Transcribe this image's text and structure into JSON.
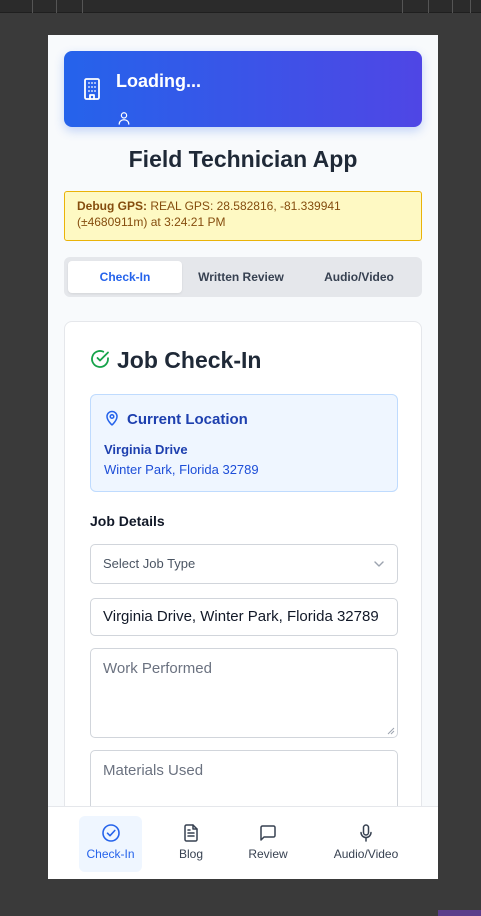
{
  "header": {
    "title": "Loading...",
    "building_icon": "building-icon",
    "user_icon": "user-icon"
  },
  "app_title": "Field Technician App",
  "debug": {
    "label": "Debug GPS:",
    "text": "REAL GPS: 28.582816, -81.339941 (±4680911m) at 3:24:21 PM"
  },
  "tabs": [
    {
      "label": "Check-In",
      "active": true
    },
    {
      "label": "Written Review",
      "active": false
    },
    {
      "label": "Audio/Video",
      "active": false
    }
  ],
  "checkin": {
    "title": "Job Check-In",
    "icon": "check-circle-icon",
    "location": {
      "title": "Current Location",
      "street": "Virginia Drive",
      "city": "Winter Park, Florida 32789"
    },
    "job_details_label": "Job Details",
    "job_type": {
      "placeholder": "Select Job Type",
      "value": ""
    },
    "address_value": "Virginia Drive, Winter Park, Florida 32789",
    "work_performed": {
      "placeholder": "Work Performed",
      "value": ""
    },
    "materials_used": {
      "placeholder": "Materials Used",
      "value": ""
    }
  },
  "bottom_nav": [
    {
      "label": "Check-In",
      "icon": "check-circle-icon",
      "active": true
    },
    {
      "label": "Blog",
      "icon": "document-icon",
      "active": false
    },
    {
      "label": "Review",
      "icon": "message-icon",
      "active": false
    },
    {
      "label": "Audio/Video",
      "icon": "microphone-icon",
      "active": false
    }
  ],
  "colors": {
    "accent": "#2563eb",
    "banner_end": "#4f46e5",
    "debug_bg": "#fef9c3",
    "location_bg": "#eff6ff",
    "success": "#16a34a"
  }
}
